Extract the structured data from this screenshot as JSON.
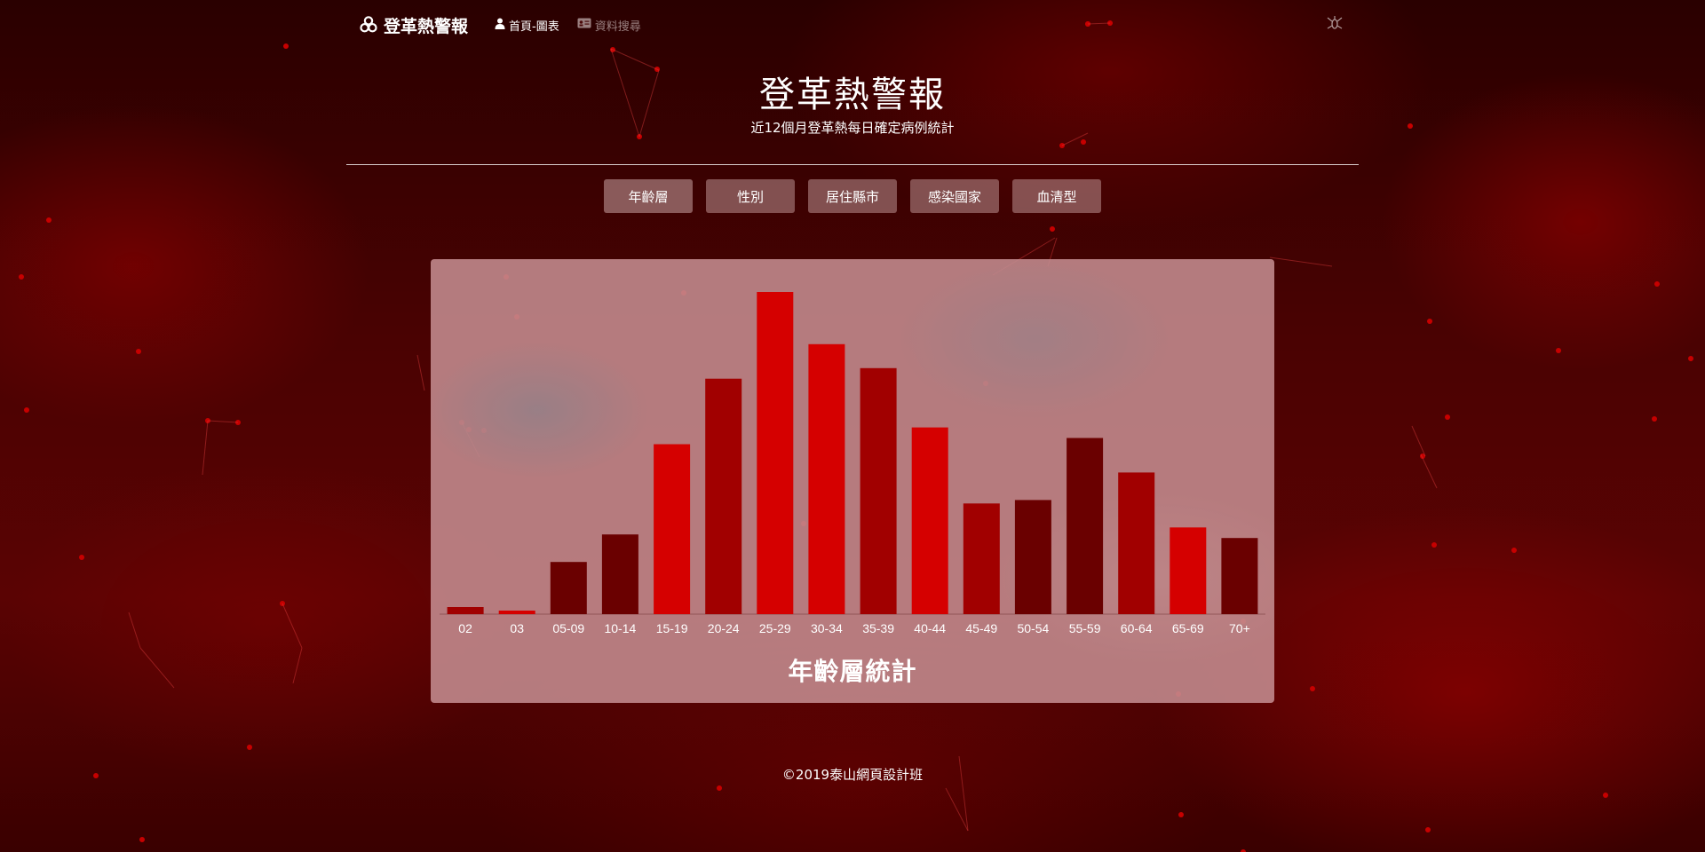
{
  "nav": {
    "brand": "登革熱警報",
    "brand_icon": "biohazard-icon",
    "home_label": "首頁-圖表",
    "home_icon": "user-icon",
    "search_label": "資料搜尋",
    "search_icon": "id-card-icon",
    "right_icon": "mosquito-icon"
  },
  "header": {
    "title": "登革熱警報",
    "subtitle": "近12個月登革熱每日確定病例統計"
  },
  "tabs": [
    "年齡層",
    "性別",
    "居住縣市",
    "感染國家",
    "血清型"
  ],
  "colors": {
    "bar_bright": "#d50000",
    "bar_mid": "#a10000",
    "bar_dark": "#6a0000"
  },
  "chart_data": {
    "type": "bar",
    "title": "年齡層統計",
    "categories": [
      "02",
      "03",
      "05-09",
      "10-14",
      "15-19",
      "20-24",
      "25-29",
      "30-34",
      "35-39",
      "40-44",
      "45-49",
      "50-54",
      "55-59",
      "60-64",
      "65-69",
      "70+"
    ],
    "values": [
      8,
      4,
      59,
      90,
      192,
      266,
      364,
      305,
      278,
      211,
      125,
      129,
      199,
      160,
      98,
      86
    ],
    "bar_colors": [
      "#a10000",
      "#d50000",
      "#6a0000",
      "#6a0000",
      "#d50000",
      "#a10000",
      "#d50000",
      "#d50000",
      "#a10000",
      "#d50000",
      "#a10000",
      "#6a0000",
      "#6a0000",
      "#a10000",
      "#d50000",
      "#6a0000"
    ],
    "ylim": [
      0,
      364
    ],
    "grid": false,
    "legend": false
  },
  "footer": "©2019泰山網頁設計班"
}
